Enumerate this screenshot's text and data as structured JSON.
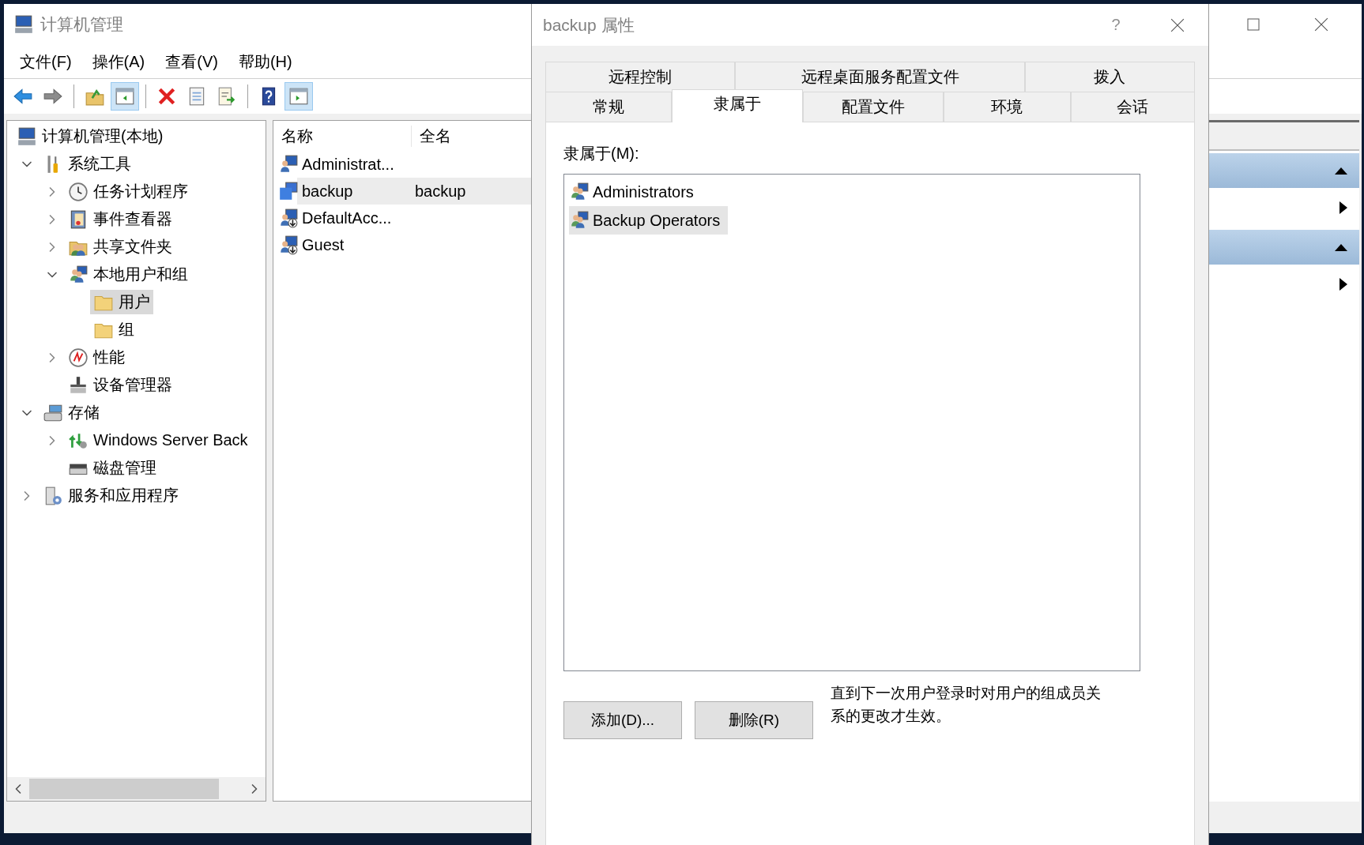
{
  "window": {
    "title": "计算机管理"
  },
  "menu": [
    {
      "label": "文件(F)"
    },
    {
      "label": "操作(A)"
    },
    {
      "label": "查看(V)"
    },
    {
      "label": "帮助(H)"
    }
  ],
  "toolbar": [
    {
      "pressed": false
    },
    {
      "pressed": false
    },
    {
      "pressed": false
    },
    {
      "pressed": true
    },
    {
      "pressed": false
    },
    {
      "pressed": false
    },
    {
      "pressed": false
    },
    {
      "pressed": false
    },
    {
      "pressed": true
    }
  ],
  "tree": [
    {
      "label": "计算机管理(本地)",
      "selected": false,
      "children": [
        {
          "label": "系统工具",
          "expanded": true,
          "selected": false,
          "children": [
            {
              "label": "任务计划程序",
              "expanded": false,
              "selected": false
            },
            {
              "label": "事件查看器",
              "expanded": false,
              "selected": false
            },
            {
              "label": "共享文件夹",
              "expanded": false,
              "selected": false
            },
            {
              "label": "本地用户和组",
              "expanded": true,
              "selected": false,
              "children": [
                {
                  "label": "用户",
                  "selected": true
                },
                {
                  "label": "组",
                  "selected": false
                }
              ]
            },
            {
              "label": "性能",
              "expanded": false,
              "selected": false
            },
            {
              "label": "设备管理器",
              "selected": false
            }
          ]
        },
        {
          "label": "存储",
          "expanded": true,
          "selected": false,
          "children": [
            {
              "label": "Windows Server Back",
              "expanded": false,
              "selected": false
            },
            {
              "label": "磁盘管理",
              "selected": false
            }
          ]
        },
        {
          "label": "服务和应用程序",
          "expanded": false,
          "selected": false
        }
      ]
    }
  ],
  "list": {
    "columns": [
      "名称",
      "全名"
    ],
    "rows": [
      {
        "name": "Administrat...",
        "selected": false
      },
      {
        "name": "backup",
        "full_name": "backup",
        "selected": true
      },
      {
        "name": "DefaultAcc...",
        "selected": false
      },
      {
        "name": "Guest",
        "selected": false
      }
    ]
  },
  "action_sections": [
    {
      "expanded": true
    },
    {
      "expanded": true
    }
  ],
  "dialog": {
    "title": "backup 属性",
    "help": "?",
    "tab_rows": [
      [
        {
          "label": "远程控制",
          "selected": false
        },
        {
          "label": "远程桌面服务配置文件",
          "selected": false
        },
        {
          "label": "拨入",
          "selected": false
        }
      ],
      [
        {
          "label": "常规",
          "selected": false
        },
        {
          "label": "隶属于",
          "selected": true
        },
        {
          "label": "配置文件",
          "selected": false
        },
        {
          "label": "环境",
          "selected": false
        },
        {
          "label": "会话",
          "selected": false
        }
      ]
    ],
    "group_label": "隶属于(M):",
    "members": [
      {
        "name": "Administrators",
        "selected": false
      },
      {
        "name": "Backup Operators",
        "selected": true
      }
    ],
    "buttons": [
      "添加(D)...",
      "删除(R)"
    ],
    "note": "直到下一次用户登录时对用户的组成员关系的更改才生效。"
  }
}
